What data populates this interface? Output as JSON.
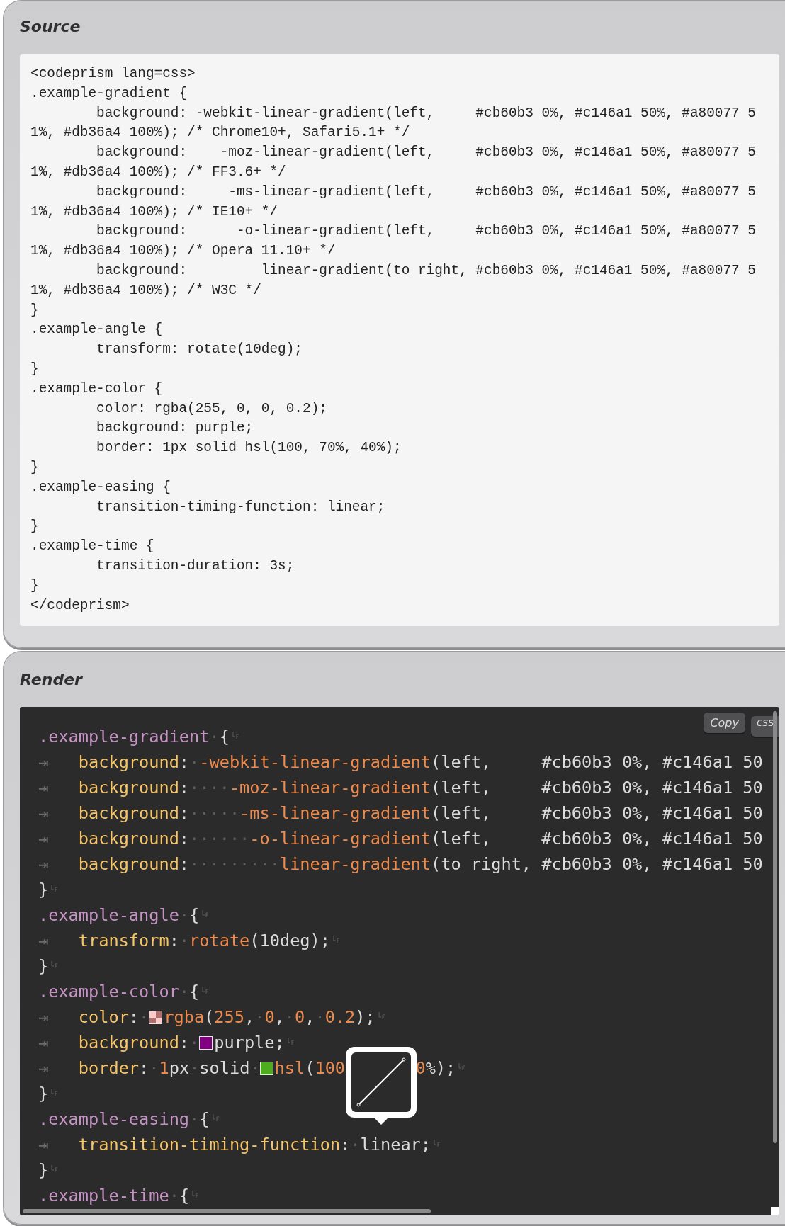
{
  "source": {
    "title": "Source",
    "lines": [
      "<codeprism lang=css>",
      ".example-gradient {",
      "        background: -webkit-linear-gradient(left,     #cb60b3 0%, #c146a1 50%, #a80077 5",
      "1%, #db36a4 100%); /* Chrome10+, Safari5.1+ */",
      "        background:    -moz-linear-gradient(left,     #cb60b3 0%, #c146a1 50%, #a80077 5",
      "1%, #db36a4 100%); /* FF3.6+ */",
      "        background:     -ms-linear-gradient(left,     #cb60b3 0%, #c146a1 50%, #a80077 5",
      "1%, #db36a4 100%); /* IE10+ */",
      "        background:      -o-linear-gradient(left,     #cb60b3 0%, #c146a1 50%, #a80077 5",
      "1%, #db36a4 100%); /* Opera 11.10+ */",
      "        background:         linear-gradient(to right, #cb60b3 0%, #c146a1 50%, #a80077 5",
      "1%, #db36a4 100%); /* W3C */",
      "}",
      ".example-angle {",
      "        transform: rotate(10deg);",
      "}",
      ".example-color {",
      "        color: rgba(255, 0, 0, 0.2);",
      "        background: purple;",
      "        border: 1px solid hsl(100, 70%, 40%);",
      "}",
      ".example-easing {",
      "        transition-timing-function: linear;",
      "}",
      ".example-time {",
      "        transition-duration: 3s;",
      "}",
      "</codeprism>"
    ]
  },
  "render": {
    "title": "Render",
    "copy_label": "Copy",
    "language": "css",
    "lines": [
      {
        "line_end_mark": true,
        "tokens": [
          {
            "kind": "sel",
            "text": ".example-gradient"
          },
          {
            "kind": "ws",
            "text": "·"
          },
          {
            "kind": "plain",
            "text": "{"
          }
        ]
      },
      {
        "line_end_mark": false,
        "tokens": [
          {
            "kind": "tab",
            "text": "⇥"
          },
          {
            "kind": "prop",
            "text": "background"
          },
          {
            "kind": "plain",
            "text": ":"
          },
          {
            "kind": "ws",
            "text": "·"
          },
          {
            "kind": "func",
            "text": "-webkit-linear-gradient"
          },
          {
            "kind": "plain",
            "text": "(left,     #cb60b3 0%, #c146a1 50"
          }
        ]
      },
      {
        "line_end_mark": false,
        "tokens": [
          {
            "kind": "tab",
            "text": "⇥"
          },
          {
            "kind": "prop",
            "text": "background"
          },
          {
            "kind": "plain",
            "text": ":"
          },
          {
            "kind": "ws",
            "text": "····"
          },
          {
            "kind": "func",
            "text": "-moz-linear-gradient"
          },
          {
            "kind": "plain",
            "text": "(left,     #cb60b3 0%, #c146a1 50"
          }
        ]
      },
      {
        "line_end_mark": false,
        "tokens": [
          {
            "kind": "tab",
            "text": "⇥"
          },
          {
            "kind": "prop",
            "text": "background"
          },
          {
            "kind": "plain",
            "text": ":"
          },
          {
            "kind": "ws",
            "text": "·····"
          },
          {
            "kind": "func",
            "text": "-ms-linear-gradient"
          },
          {
            "kind": "plain",
            "text": "(left,     #cb60b3 0%, #c146a1 50"
          }
        ]
      },
      {
        "line_end_mark": false,
        "tokens": [
          {
            "kind": "tab",
            "text": "⇥"
          },
          {
            "kind": "prop",
            "text": "background"
          },
          {
            "kind": "plain",
            "text": ":"
          },
          {
            "kind": "ws",
            "text": "······"
          },
          {
            "kind": "func",
            "text": "-o-linear-gradient"
          },
          {
            "kind": "plain",
            "text": "(left,     #cb60b3 0%, #c146a1 50"
          }
        ]
      },
      {
        "line_end_mark": false,
        "tokens": [
          {
            "kind": "tab",
            "text": "⇥"
          },
          {
            "kind": "prop",
            "text": "background"
          },
          {
            "kind": "plain",
            "text": ":"
          },
          {
            "kind": "ws",
            "text": "·········"
          },
          {
            "kind": "func",
            "text": "linear-gradient"
          },
          {
            "kind": "plain",
            "text": "(to right, #cb60b3 0%, #c146a1 50"
          }
        ]
      },
      {
        "line_end_mark": true,
        "tokens": [
          {
            "kind": "plain",
            "text": "}"
          }
        ]
      },
      {
        "line_end_mark": true,
        "tokens": [
          {
            "kind": "sel",
            "text": ".example-angle"
          },
          {
            "kind": "ws",
            "text": "·"
          },
          {
            "kind": "plain",
            "text": "{"
          }
        ]
      },
      {
        "line_end_mark": true,
        "tokens": [
          {
            "kind": "tab",
            "text": "⇥"
          },
          {
            "kind": "prop",
            "text": "transform"
          },
          {
            "kind": "plain",
            "text": ":"
          },
          {
            "kind": "ws",
            "text": "·"
          },
          {
            "kind": "func",
            "text": "rotate"
          },
          {
            "kind": "plain",
            "text": "(10deg);"
          }
        ]
      },
      {
        "line_end_mark": true,
        "tokens": [
          {
            "kind": "plain",
            "text": "}"
          }
        ]
      },
      {
        "line_end_mark": true,
        "tokens": [
          {
            "kind": "sel",
            "text": ".example-color"
          },
          {
            "kind": "ws",
            "text": "·"
          },
          {
            "kind": "plain",
            "text": "{"
          }
        ]
      },
      {
        "line_end_mark": true,
        "tokens": [
          {
            "kind": "tab",
            "text": "⇥"
          },
          {
            "kind": "prop",
            "text": "color"
          },
          {
            "kind": "plain",
            "text": ":"
          },
          {
            "kind": "ws",
            "text": "·"
          },
          {
            "kind": "alpha-swatch",
            "color": "#ffcccc"
          },
          {
            "kind": "func",
            "text": "rgba"
          },
          {
            "kind": "plain",
            "text": "("
          },
          {
            "kind": "num",
            "text": "255"
          },
          {
            "kind": "plain",
            "text": ","
          },
          {
            "kind": "ws",
            "text": "·"
          },
          {
            "kind": "num",
            "text": "0"
          },
          {
            "kind": "plain",
            "text": ","
          },
          {
            "kind": "ws",
            "text": "·"
          },
          {
            "kind": "num",
            "text": "0"
          },
          {
            "kind": "plain",
            "text": ","
          },
          {
            "kind": "ws",
            "text": "·"
          },
          {
            "kind": "num",
            "text": "0.2"
          },
          {
            "kind": "plain",
            "text": ");"
          }
        ]
      },
      {
        "line_end_mark": true,
        "tokens": [
          {
            "kind": "tab",
            "text": "⇥"
          },
          {
            "kind": "prop",
            "text": "background"
          },
          {
            "kind": "plain",
            "text": ":"
          },
          {
            "kind": "ws",
            "text": "·"
          },
          {
            "kind": "swatch",
            "color": "#800080"
          },
          {
            "kind": "plain",
            "text": "purple;"
          }
        ]
      },
      {
        "line_end_mark": true,
        "tokens": [
          {
            "kind": "tab",
            "text": "⇥"
          },
          {
            "kind": "prop",
            "text": "border"
          },
          {
            "kind": "plain",
            "text": ":"
          },
          {
            "kind": "ws",
            "text": "·"
          },
          {
            "kind": "num",
            "text": "1"
          },
          {
            "kind": "plain",
            "text": "px"
          },
          {
            "kind": "ws",
            "text": "·"
          },
          {
            "kind": "plain",
            "text": "solid"
          },
          {
            "kind": "ws",
            "text": "·"
          },
          {
            "kind": "swatch",
            "color": "#4ead1f"
          },
          {
            "kind": "func",
            "text": "hsl"
          },
          {
            "kind": "plain",
            "text": "("
          },
          {
            "kind": "num",
            "text": "100"
          },
          {
            "kind": "easing-popup"
          },
          {
            "kind": "num",
            "text": "0"
          },
          {
            "kind": "plain",
            "text": "%);"
          }
        ]
      },
      {
        "line_end_mark": true,
        "tokens": [
          {
            "kind": "plain",
            "text": "}"
          }
        ]
      },
      {
        "line_end_mark": true,
        "tokens": [
          {
            "kind": "sel",
            "text": ".example-easing"
          },
          {
            "kind": "ws",
            "text": "·"
          },
          {
            "kind": "plain",
            "text": "{"
          }
        ]
      },
      {
        "line_end_mark": true,
        "tokens": [
          {
            "kind": "tab",
            "text": "⇥"
          },
          {
            "kind": "prop",
            "text": "transition-timing-function"
          },
          {
            "kind": "plain",
            "text": ":"
          },
          {
            "kind": "ws",
            "text": "·"
          },
          {
            "kind": "plain",
            "text": "linear;"
          }
        ]
      },
      {
        "line_end_mark": true,
        "tokens": [
          {
            "kind": "plain",
            "text": "}"
          }
        ]
      },
      {
        "line_end_mark": true,
        "tokens": [
          {
            "kind": "sel",
            "text": ".example-time"
          },
          {
            "kind": "ws",
            "text": "·"
          },
          {
            "kind": "plain",
            "text": "{"
          }
        ]
      }
    ]
  }
}
